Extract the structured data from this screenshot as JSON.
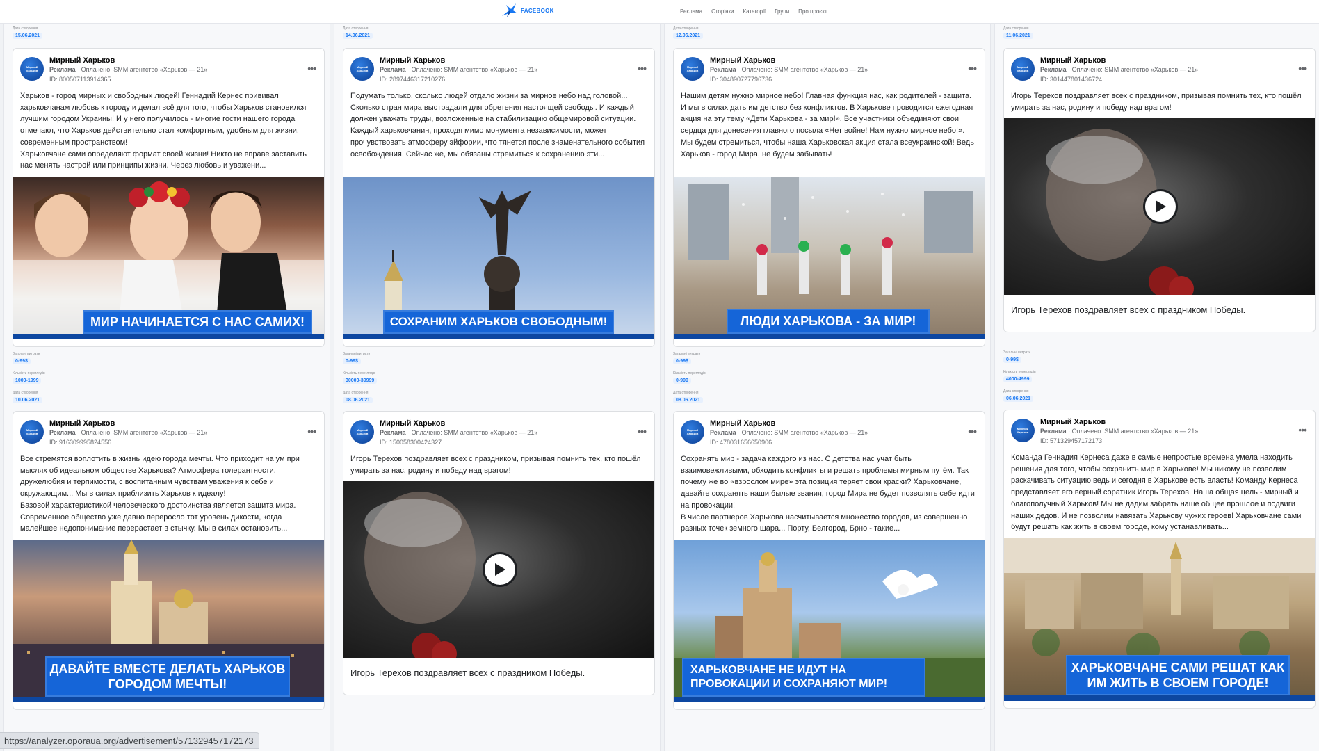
{
  "header": {
    "logo_text": "FACEBOOK",
    "nav": [
      "Реклама",
      "Сторінки",
      "Категорії",
      "Групи",
      "Про проєкт"
    ]
  },
  "labels": {
    "date": "Дата створення",
    "reach": "Загальні витрати",
    "impressions": "Кількість переглядів"
  },
  "advertiser": {
    "name": "Мирный Харьков",
    "ad_prefix": "Реклама",
    "paid_label": "Оплачено:",
    "payer": "SMM агентство «Харьков — 21»",
    "avatar_text": "Мирный Харьков"
  },
  "cards": [
    {
      "date": "15.06.2021",
      "id": "ID: 800507113914365",
      "text": "Харьков - город мирных и свободных людей! Геннадий Кернес прививал харьковчанам любовь к городу и делал всё для того, чтобы Харьков становился лучшим городом Украины! И у него получилось - многие гости нашего города отмечают, что Харьков действительно стал комфортным, удобным для жизни, современным пространством!\nХарьковчане сами определяют формат своей жизни! Никто не вправе заставить нас менять настрой или принципы жизни. Через любовь и уважени...",
      "banner": "МИР НАЧИНАЕТСЯ С НАС САМИХ!"
    },
    {
      "date": "14.06.2021",
      "id": "ID: 2897446317210276",
      "text": "Подумать только, сколько людей отдало жизни за мирное небо над головой...\nСколько стран мира выстрадали для обретения настоящей свободы. И каждый должен уважать труды, возложенные на стабилизацию общемировой ситуации.\nКаждый харьковчанин, проходя мимо монумента независимости, может прочувствовать атмосферу эйфории, что тянется после знаменательного события освобождения. Сейчас же, мы обязаны стремиться к сохранению эти...",
      "banner": "СОХРАНИМ ХАРЬКОВ СВОБОДНЫМ!"
    },
    {
      "date": "12.06.2021",
      "id": "ID: 304890727796736",
      "text": "Нашим детям нужно мирное небо! Главная функция нас, как родителей - защита. И мы в силах дать им детство без конфликтов. В Харькове проводится ежегодная акция на эту тему «Дети Харькова - за мир!». Все участники объединяют свои сердца для донесения главного посыла «Нет войне! Нам нужно мирное небо!».\nМы будем стремиться, чтобы наша Харьковская акция стала всеукраинской! Ведь Харьков - город Мира, не будем забывать!",
      "banner": "ЛЮДИ ХАРЬКОВА - ЗА МИР!"
    },
    {
      "date": "11.06.2021",
      "id": "ID: 301447801436724",
      "text": "Игорь Терехов поздравляет всех с праздником, призывая помнить тех, кто пошёл умирать за нас, родину и победу над врагом!",
      "caption": "Игорь Терехов поздравляет всех с праздником Победы."
    },
    {
      "reach": "0-99$",
      "impressions": "1000-1999",
      "date": "10.06.2021",
      "id": "ID: 916309995824556",
      "text": "Все стремятся воплотить в жизнь идею города мечты. Что приходит на ум при мыслях об идеальном обществе Харькова? Атмосфера толерантности, дружелюбия и терпимости, с воспитанным чувствам уважения к себе и окружающим... Мы в силах приблизить Харьков к идеалу!\nБазовой характеристикой человеческого достоинства является защита мира. Современное общество уже давно переросло тот уровень дикости, когда малейшее недопонимание перерастает в стычку. Мы в силах остановить...",
      "banner": "ДАВАЙТЕ ВМЕСТЕ ДЕЛАТЬ ХАРЬКОВ ГОРОДОМ МЕЧТЫ!"
    },
    {
      "reach": "0-99$",
      "impressions": "30000-39999",
      "date": "08.06.2021",
      "id": "ID: 150058300424327",
      "text": "Игорь Терехов поздравляет всех с праздником, призывая помнить тех, кто пошёл умирать за нас, родину и победу над врагом!",
      "caption": "Игорь Терехов поздравляет всех с праздником Победы."
    },
    {
      "reach": "0-99$",
      "impressions": "0-999",
      "date": "08.06.2021",
      "id": "ID: 478031656650906",
      "text": "Сохранять мир - задача каждого из нас. С детства нас учат быть взаимовежливыми, обходить конфликты и решать проблемы мирным путём. Так почему же во «взрослом мире» эта позиция теряет свои краски? Харьковчане, давайте сохранять наши былые звания, город Мира не будет позволять себе идти на провокации!\nВ числе партнеров Харькова насчитывается множество городов, из совершенно разных точек земного шара... Порту, Белгород, Брно - такие...",
      "banner": "ХАРЬКОВЧАНЕ НЕ ИДУТ НА ПРОВОКАЦИИ И СОХРАНЯЮТ МИР!"
    },
    {
      "reach": "0-99$",
      "impressions": "4000-4999",
      "date": "06.06.2021",
      "id": "ID: 571329457172173",
      "text": "Команда Геннадия Кернеса даже в самые непростые времена умела находить решения для того, чтобы сохранить мир в Харькове! Мы никому не позволим раскачивать ситуацию ведь и сегодня в Харькове есть власть! Команду Кернеса представляет его верный соратник Игорь Терехов. Наша общая цель - мирный и благополучный Харьков! Мы не дадим забрать наше общее прошлое и подвиги наших дедов. И не позволим навязать Харькову чужих героев! Харьковчане сами будут решать как жить в своем городе, кому устанавливать...",
      "banner": "ХАРЬКОВЧАНЕ САМИ РЕШАТ КАК ИМ ЖИТЬ В СВОЕМ ГОРОДЕ!"
    }
  ],
  "status_url": "https://analyzer.oporaua.org/advertisement/571329457172173"
}
